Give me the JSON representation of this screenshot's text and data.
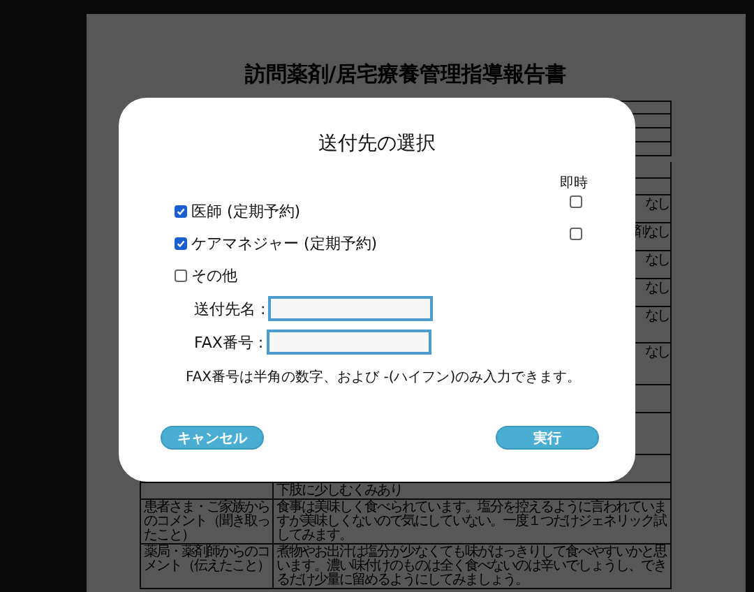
{
  "document": {
    "title": "訪問薬剤/居宅療養管理指導報告書",
    "rows": [
      {
        "kind": "fragment",
        "value": "なし"
      },
      {
        "kind": "fragment",
        "value": "剤なし"
      },
      {
        "kind": "fragment",
        "value": "なし"
      },
      {
        "kind": "fragment",
        "value": "なし"
      },
      {
        "kind": "fragment",
        "value": "なし"
      },
      {
        "kind": "fragment",
        "value": "なし"
      },
      {
        "kind": "full",
        "value": "下肢に少しむくみあり"
      },
      {
        "kind": "full",
        "label": "患者さま・ご家族からのコメント（聞き取ったこと）",
        "value": "食事は美味しく食べられています。塩分を控えるように言われていますが美味しくないので気にしていない。一度１つだけジェネリック試してみます。"
      },
      {
        "kind": "full",
        "label": "薬局・薬剤師からのコメント（伝えたこと）",
        "value": "煮物やお出汁は塩分が少なくても味がはっきりして食べやすいかと思います。濃い味付けのものは全く食べないのは辛いでしょうし、できるだけ少量に留めるようにしてみましょう。"
      }
    ]
  },
  "modal": {
    "title": "送付先の選択",
    "immediate_header": "即時",
    "recipients": [
      {
        "label": "医師 (定期予約)",
        "checked": true,
        "immediate_checked": false
      },
      {
        "label": "ケアマネジャー (定期予約)",
        "checked": true,
        "immediate_checked": false
      }
    ],
    "other": {
      "label": "その他",
      "checked": false
    },
    "fields": [
      {
        "label": "送付先名 :"
      },
      {
        "label": "FAX番号 :"
      }
    ],
    "note": "FAX番号は半角の数字、および -(ハイフン)のみ入力できます。",
    "buttons": [
      {
        "label": "キャンセル",
        "kind": "cancel"
      },
      {
        "label": "実行",
        "kind": "primary"
      }
    ]
  }
}
